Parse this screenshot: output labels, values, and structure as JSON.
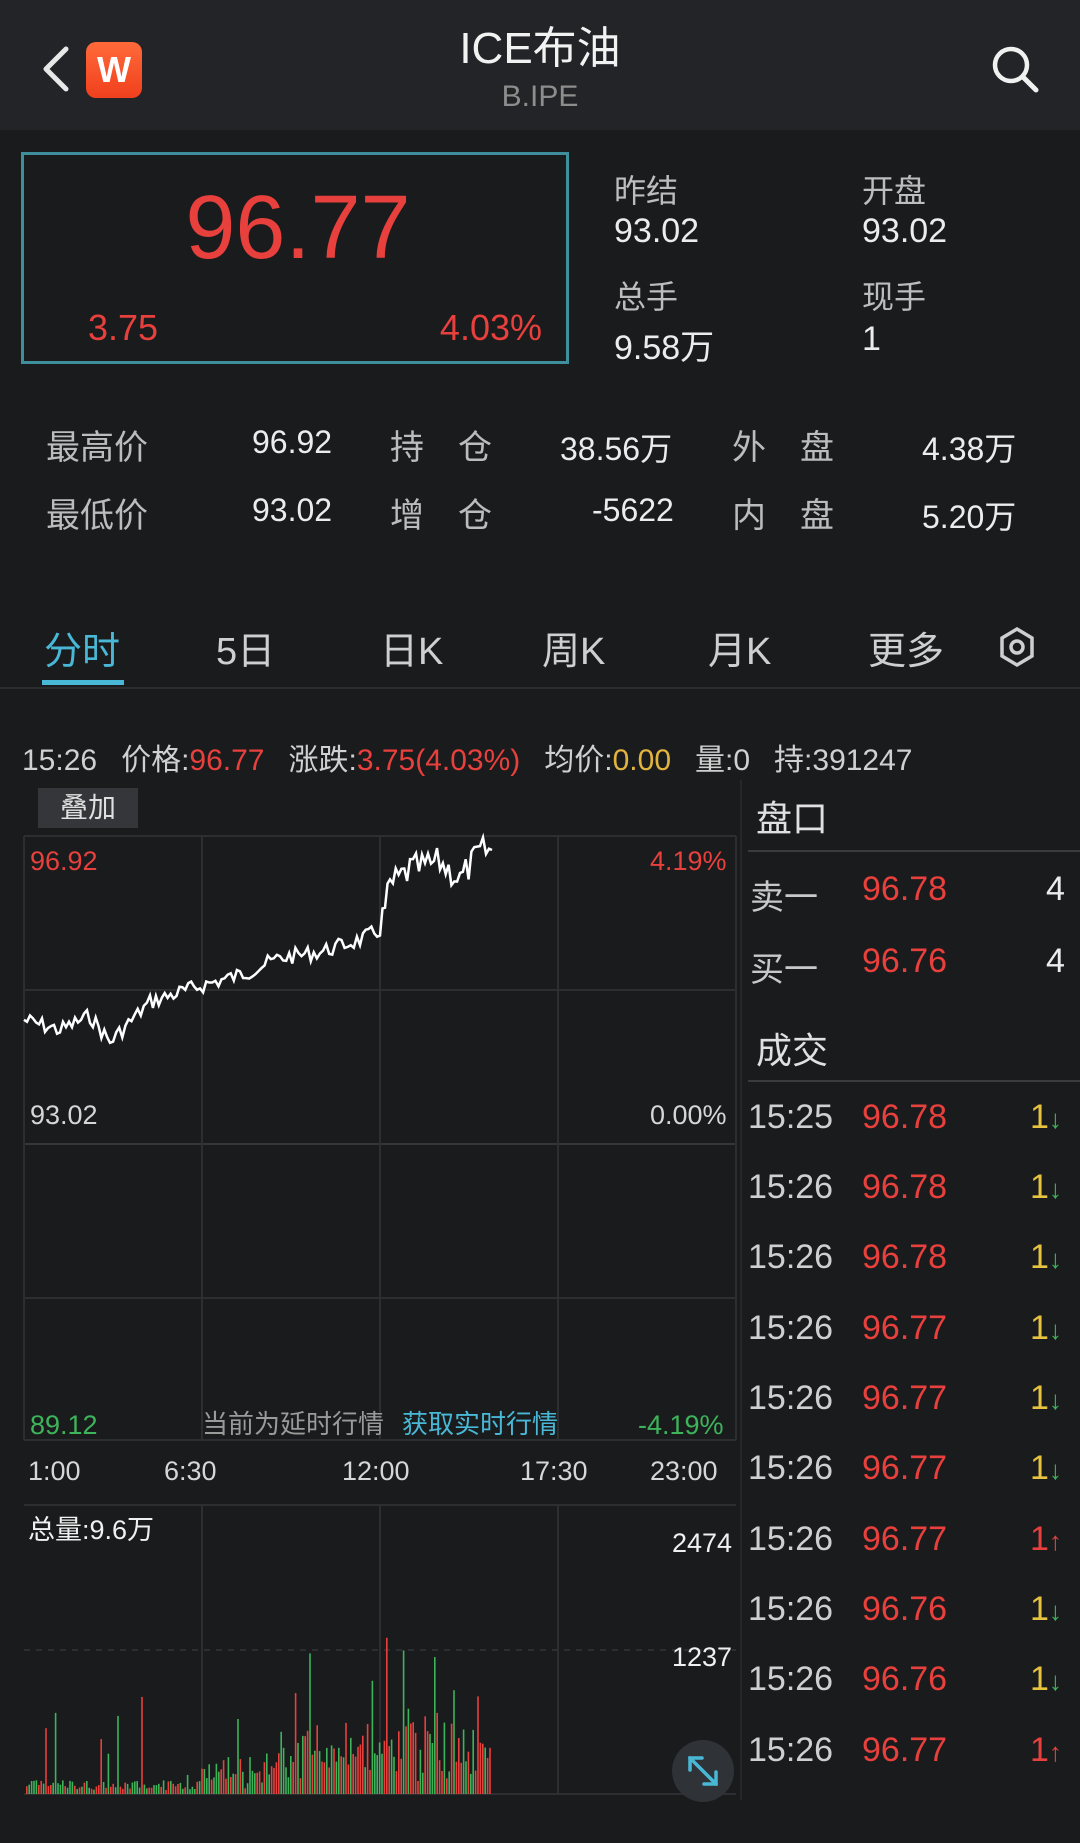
{
  "header": {
    "title": "ICE布油",
    "subtitle": "B.IPE",
    "logo_letter": "W"
  },
  "quote": {
    "price": "96.77",
    "change": "3.75",
    "change_pct": "4.03%",
    "prev_settle_label": "昨结",
    "prev_settle": "93.02",
    "open_label": "开盘",
    "open": "93.02",
    "total_volume_label": "总手",
    "total_volume": "9.58万",
    "current_volume_label": "现手",
    "current_volume": "1"
  },
  "stats": {
    "high_label": "最高价",
    "high": "96.92",
    "low_label": "最低价",
    "low": "93.02",
    "oi_label": "持　仓",
    "oi": "38.56万",
    "oi_change_label": "增　仓",
    "oi_change": "-5622",
    "outer_label": "外　盘",
    "outer": "4.38万",
    "inner_label": "内　盘",
    "inner": "5.20万"
  },
  "tabs": [
    "分时",
    "5日",
    "日K",
    "周K",
    "月K",
    "更多"
  ],
  "infobar": {
    "time": "15:26",
    "price_label": "价格:",
    "price": "96.77",
    "change_label": "涨跌:",
    "change": "3.75(4.03%)",
    "avg_label": "均价:",
    "avg": "0.00",
    "vol_label": "量:0",
    "hold_label": "持:391247"
  },
  "chart": {
    "overlay_label": "叠加",
    "y_high": "96.92",
    "y_mid": "93.02",
    "y_low": "89.12",
    "pct_high": "4.19%",
    "pct_mid": "0.00%",
    "pct_low": "-4.19%",
    "delay_note": "当前为延时行情",
    "realtime_link": "获取实时行情",
    "x_ticks": [
      "1:00",
      "6:30",
      "12:00",
      "17:30",
      "23:00"
    ],
    "volume_total": "总量:9.6万",
    "vol_max": "2474",
    "vol_mid": "1237"
  },
  "colors": {
    "up": "#e8403c",
    "down": "#3db35a",
    "accent": "#49b8d6",
    "line": "#ffffff"
  },
  "panel": {
    "orderbook_title": "盘口",
    "ask_label": "卖一",
    "ask_price": "96.78",
    "ask_vol": "4",
    "bid_label": "买一",
    "bid_price": "96.76",
    "bid_vol": "4",
    "trades_title": "成交",
    "trades": [
      {
        "time": "15:25",
        "price": "96.78",
        "vol": "1",
        "dir": "down"
      },
      {
        "time": "15:26",
        "price": "96.78",
        "vol": "1",
        "dir": "down"
      },
      {
        "time": "15:26",
        "price": "96.78",
        "vol": "1",
        "dir": "down"
      },
      {
        "time": "15:26",
        "price": "96.77",
        "vol": "1",
        "dir": "down"
      },
      {
        "time": "15:26",
        "price": "96.77",
        "vol": "1",
        "dir": "down"
      },
      {
        "time": "15:26",
        "price": "96.77",
        "vol": "1",
        "dir": "down"
      },
      {
        "time": "15:26",
        "price": "96.77",
        "vol": "1",
        "dir": "up"
      },
      {
        "time": "15:26",
        "price": "96.76",
        "vol": "1",
        "dir": "down"
      },
      {
        "time": "15:26",
        "price": "96.76",
        "vol": "1",
        "dir": "down"
      },
      {
        "time": "15:26",
        "price": "96.77",
        "vol": "1",
        "dir": "up"
      }
    ]
  }
}
